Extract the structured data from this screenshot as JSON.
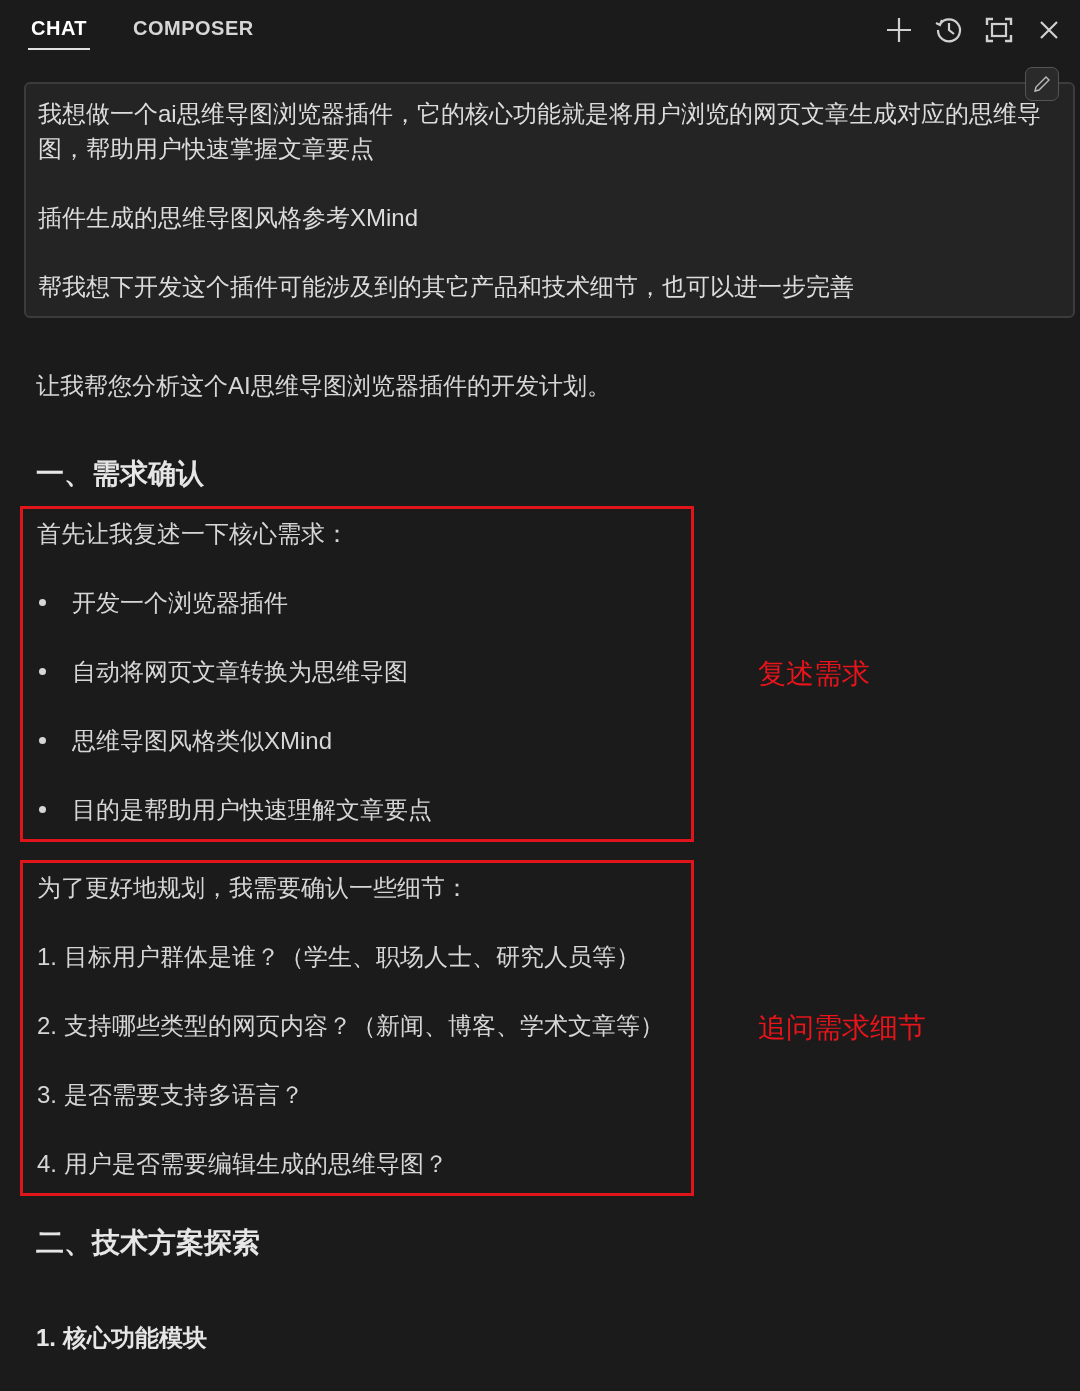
{
  "tabs": [
    {
      "label": "CHAT",
      "selected": true
    },
    {
      "label": "COMPOSER",
      "selected": false
    }
  ],
  "user_message": {
    "paragraphs": [
      "我想做一个ai思维导图浏览器插件，它的核心功能就是将用户浏览的网页文章生成对应的思维导图，帮助用户快速掌握文章要点",
      "插件生成的思维导图风格参考XMind",
      "帮我想下开发这个插件可能涉及到的其它产品和技术细节，也可以进一步完善"
    ]
  },
  "response": [
    {
      "kind": "paragraph",
      "text": "让我帮您分析这个AI思维导图浏览器插件的开发计划。"
    },
    {
      "kind": "heading",
      "text": "一、需求确认"
    },
    {
      "kind": "annotated",
      "lead": "首先让我复述一下核心需求：",
      "bulleted": true,
      "annotation": "复述需求",
      "items": [
        "开发一个浏览器插件",
        "自动将网页文章转换为思维导图",
        "思维导图风格类似XMind",
        "目的是帮助用户快速理解文章要点"
      ]
    },
    {
      "kind": "annotated",
      "lead": "为了更好地规划，我需要确认一些细节：",
      "bulleted": false,
      "annotation": "追问需求细节",
      "items": [
        "1. 目标用户群体是谁？（学生、职场人士、研究人员等）",
        "2. 支持哪些类型的网页内容？（新闻、博客、学术文章等）",
        "3. 是否需要支持多语言？",
        "4. 用户是否需要编辑生成的思维导图？"
      ]
    },
    {
      "kind": "heading",
      "text": "二、技术方案探索"
    },
    {
      "kind": "subheading",
      "text": "1. 核心功能模块"
    }
  ]
}
